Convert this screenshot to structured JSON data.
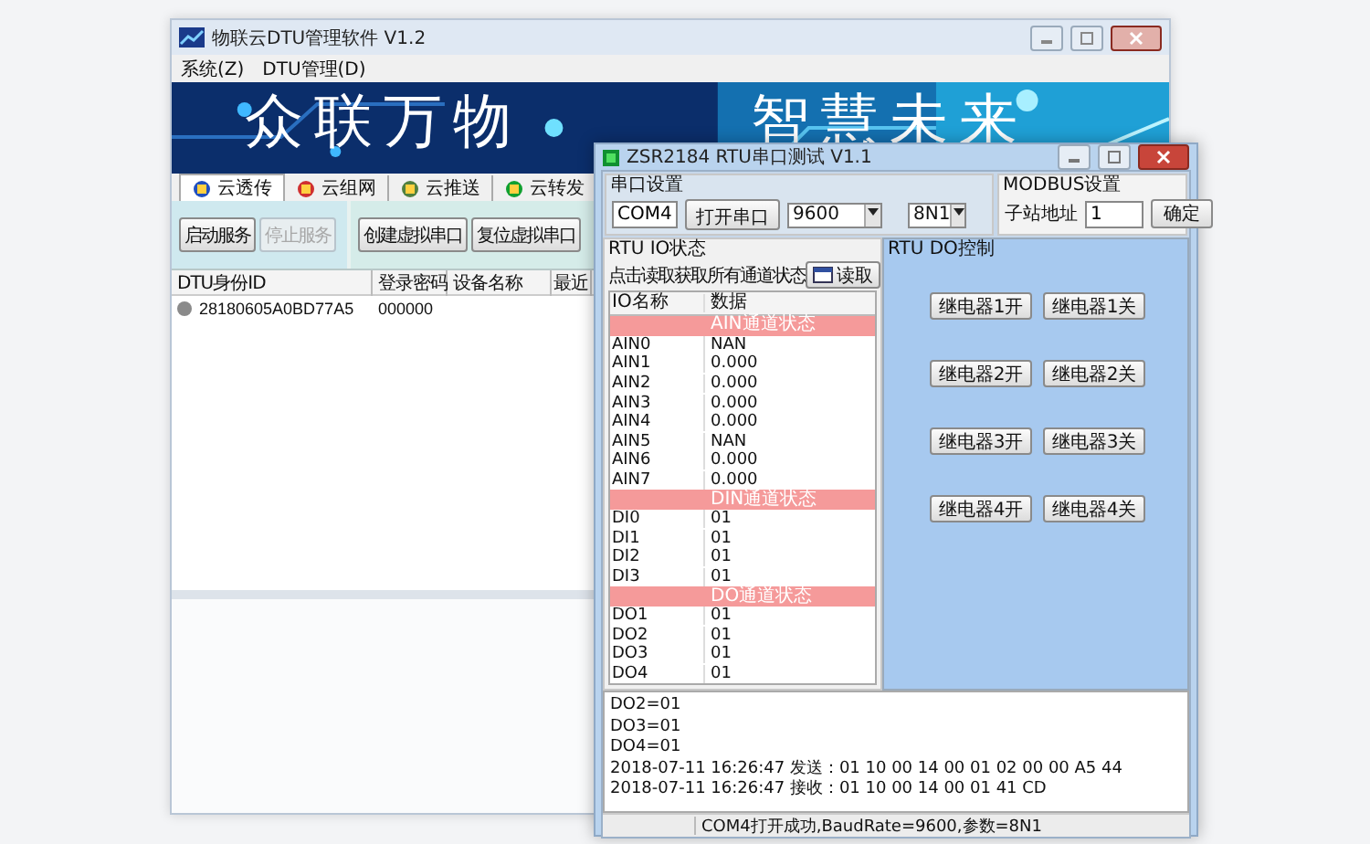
{
  "main_window": {
    "title": "物联云DTU管理软件 V1.2",
    "menu": [
      "系统(Z)",
      "DTU管理(D)"
    ],
    "banner": [
      "众联万物",
      "智慧未来"
    ],
    "tabs": [
      {
        "label": "云透传",
        "selected": true
      },
      {
        "label": "云组网",
        "selected": false
      },
      {
        "label": "云推送",
        "selected": false
      },
      {
        "label": "云转发",
        "selected": false
      }
    ],
    "buttons": [
      {
        "label": "启动服务",
        "disabled": false
      },
      {
        "label": "停止服务",
        "disabled": true
      },
      {
        "label": "创建虚拟串口",
        "disabled": false
      },
      {
        "label": "复位虚拟串口",
        "disabled": false
      }
    ],
    "table": {
      "columns": [
        "DTU身份ID",
        "登录密码",
        "设备名称",
        "最近"
      ],
      "rows": [
        {
          "online": false,
          "cells": [
            "28180605A0BD77A5",
            "000000"
          ]
        }
      ]
    }
  },
  "test_window": {
    "title": "ZSR2184 RTU串口测试 V1.1",
    "serial": {
      "title": "串口设置",
      "port": "COM4",
      "open_button": "打开串口",
      "baud": "9600",
      "format": "8N1"
    },
    "modbus": {
      "title": "MODBUS设置",
      "address_label": "子站地址",
      "address": "1",
      "confirm": "确定"
    },
    "io_status": {
      "title": "RTU IO状态",
      "hint": "点击读取获取所有通道状态",
      "read_button": "读取",
      "columns": [
        "IO名称",
        "数据"
      ],
      "rows": [
        {
          "kind": "section",
          "label": "AIN通道状态"
        },
        {
          "kind": "value",
          "name": "AIN0",
          "value": "NAN"
        },
        {
          "kind": "value",
          "name": "AIN1",
          "value": "0.000"
        },
        {
          "kind": "value",
          "name": "AIN2",
          "value": "0.000"
        },
        {
          "kind": "value",
          "name": "AIN3",
          "value": "0.000"
        },
        {
          "kind": "value",
          "name": "AIN4",
          "value": "0.000"
        },
        {
          "kind": "value",
          "name": "AIN5",
          "value": "NAN"
        },
        {
          "kind": "value",
          "name": "AIN6",
          "value": "0.000"
        },
        {
          "kind": "value",
          "name": "AIN7",
          "value": "0.000"
        },
        {
          "kind": "section",
          "label": "DIN通道状态"
        },
        {
          "kind": "value",
          "name": "DI0",
          "value": "01"
        },
        {
          "kind": "value",
          "name": "DI1",
          "value": "01"
        },
        {
          "kind": "value",
          "name": "DI2",
          "value": "01"
        },
        {
          "kind": "value",
          "name": "DI3",
          "value": "01"
        },
        {
          "kind": "section",
          "label": "DO通道状态"
        },
        {
          "kind": "value",
          "name": "DO1",
          "value": "01"
        },
        {
          "kind": "value",
          "name": "DO2",
          "value": "01"
        },
        {
          "kind": "value",
          "name": "DO3",
          "value": "01"
        },
        {
          "kind": "value",
          "name": "DO4",
          "value": "01"
        }
      ]
    },
    "do_control": {
      "title": "RTU DO控制",
      "buttons": [
        "继电器1开",
        "继电器1关",
        "继电器2开",
        "继电器2关",
        "继电器3开",
        "继电器3关",
        "继电器4开",
        "继电器4关"
      ]
    },
    "log": [
      "DO2=01",
      "DO3=01",
      "DO4=01",
      "2018-07-11 16:26:47 发送：01 10 00 14 00 01 02 00 00 A5 44",
      "2018-07-11 16:26:47 接收：01 10 00 14 00 01 41 CD"
    ],
    "status": "COM4打开成功,BaudRate=9600,参数=8N1"
  }
}
